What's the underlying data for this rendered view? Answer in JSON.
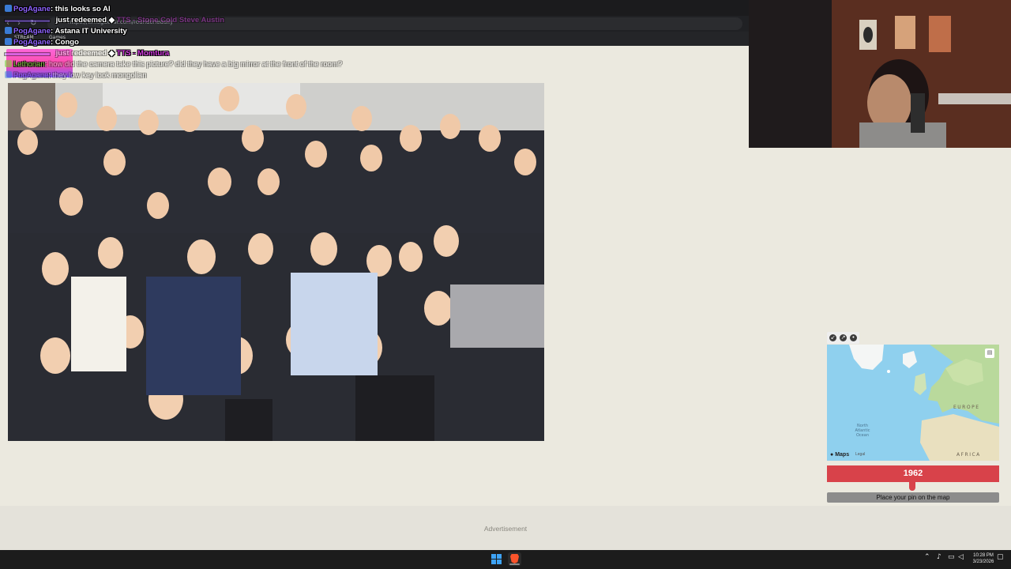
{
  "browser": {
    "url": "https://timeguessr.com/roundonedaily",
    "bookmarks": [
      "STREAM",
      "Games"
    ]
  },
  "chat": [
    {
      "user": "PogAgane",
      "message": "this looks so AI"
    },
    {
      "user": "",
      "message": "just redeemed",
      "reward": "TTS - Stone Cold Steve Austin"
    },
    {
      "user": "PogAgane",
      "message": "Astana IT University"
    },
    {
      "user": "PogAgane",
      "message": "Congo"
    },
    {
      "user": "",
      "message": "just redeemed",
      "reward": "TTS - Momtura"
    },
    {
      "user": "Lethorian",
      "message": "how did the camera take this picture? did they have a big mirror at the front of the room?"
    },
    {
      "user": "PogAgane",
      "message": "they low key look mongolian"
    }
  ],
  "map": {
    "labels": {
      "europe": "EUROPE",
      "africa": "AFRICA",
      "ocean": "North Atlantic Ocean"
    },
    "brand": "Maps",
    "legal": "Legal"
  },
  "year_bar": {
    "year": "1962"
  },
  "pin_button": {
    "label": "Place your pin on the map"
  },
  "ad": {
    "label": "Advertisement"
  },
  "taskbar": {
    "time": "10:28 PM",
    "date": "3/23/2026"
  },
  "colors": {
    "accent": "#d8424a",
    "background": "#ebe9df"
  }
}
